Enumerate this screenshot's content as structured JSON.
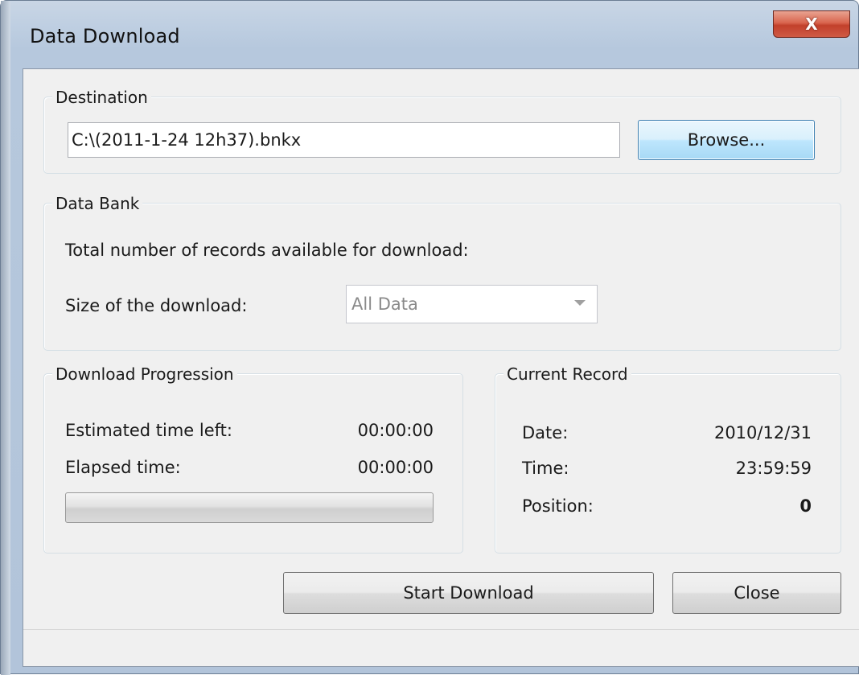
{
  "window": {
    "title": "Data Download",
    "close_glyph": "X"
  },
  "destination": {
    "group_title": "Destination",
    "path_value": "C:\\(2011-1-24 12h37).bnkx",
    "browse_label": "Browse..."
  },
  "data_bank": {
    "group_title": "Data Bank",
    "total_records_label": "Total number of records available for download:",
    "size_label": "Size of the download:",
    "size_selected": "All Data"
  },
  "progression": {
    "group_title": "Download Progression",
    "estimated_label": "Estimated time left:",
    "estimated_value": "00:00:00",
    "elapsed_label": "Elapsed time:",
    "elapsed_value": "00:00:00",
    "progress_percent": 0
  },
  "current_record": {
    "group_title": "Current Record",
    "date_label": "Date:",
    "date_value": "2010/12/31",
    "time_label": "Time:",
    "time_value": "23:59:59",
    "position_label": "Position:",
    "position_value": "0"
  },
  "actions": {
    "start_label": "Start Download",
    "close_label": "Close"
  }
}
